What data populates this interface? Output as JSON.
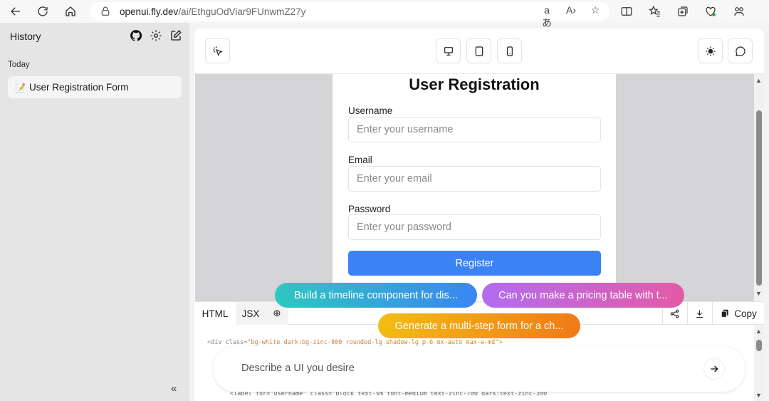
{
  "browser": {
    "url_host": "openui.fly.dev",
    "url_path": "/ai/EthguOdViar9FUnwmZ27y"
  },
  "sidebar": {
    "title": "History",
    "section": "Today",
    "items": [
      {
        "label": "User Registration Form",
        "emoji": "📝"
      }
    ],
    "collapse_label": "«"
  },
  "preview": {
    "title": "User Registration",
    "fields": [
      {
        "label": "Username",
        "placeholder": "Enter your username"
      },
      {
        "label": "Email",
        "placeholder": "Enter your email"
      },
      {
        "label": "Password",
        "placeholder": "Enter your password"
      }
    ],
    "submit_label": "Register",
    "accent_color": "#3b82f6"
  },
  "code": {
    "tabs": [
      "HTML",
      "JSX"
    ],
    "copy_label": "Copy",
    "line1_tag": "<div class=",
    "line1_str": "\"bg-white dark:bg-zinc-800 rounded-lg shadow-lg p-6 mx-auto max-w-md\"",
    "line1_end": ">",
    "line3": "<label for=\"username\" class=\"block text-sm font-medium text-zinc-700 dark:text-zinc-300"
  },
  "suggestions": [
    {
      "label": "Build a timeline component for dis...",
      "color": "#2bc4c4"
    },
    {
      "label": "Can you make a pricing table with t...",
      "color": "#c466e8"
    },
    {
      "label": "Generate a multi-step form for a ch...",
      "color": "#f5a70a"
    }
  ],
  "prompt": {
    "placeholder": "Describe a UI you desire"
  }
}
